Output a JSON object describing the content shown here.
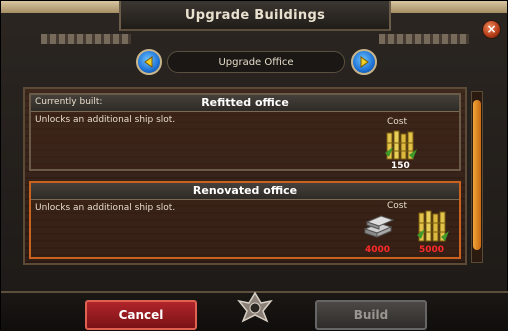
{
  "window": {
    "title": "Upgrade Buildings",
    "close_label": "×"
  },
  "navigator": {
    "title": "Upgrade Office",
    "prev_icon": "arrow-left-icon",
    "next_icon": "arrow-right-icon"
  },
  "upgrades": [
    {
      "prefix": "Currently built:",
      "name": "Refitted office",
      "description": "Unlocks an additional ship slot.",
      "cost_label": "Cost",
      "costs": [
        {
          "resource": "bamboo-icon",
          "amount": "150",
          "color": "#ffffff"
        }
      ]
    },
    {
      "prefix": "",
      "name": "Renovated office",
      "description": "Unlocks an additional ship slot.",
      "cost_label": "Cost",
      "costs": [
        {
          "resource": "metal-ingots-icon",
          "amount": "4000",
          "color": "#ff2a2a"
        },
        {
          "resource": "bamboo-icon",
          "amount": "5000",
          "color": "#ff2a2a"
        }
      ]
    }
  ],
  "buttons": {
    "cancel": "Cancel",
    "build": "Build"
  },
  "colors": {
    "selected_border": "#c9621e",
    "insufficient": "#ff2a2a",
    "cancel_bg": "#b0252a",
    "nav_blue": "#1d72d6"
  }
}
